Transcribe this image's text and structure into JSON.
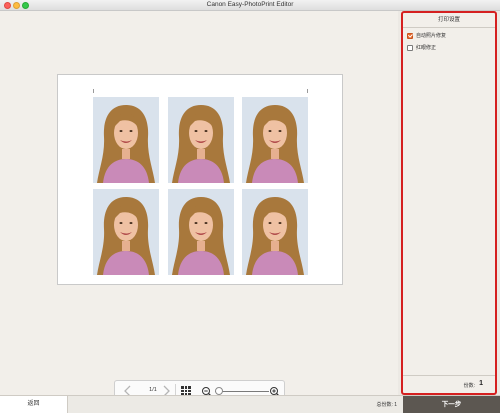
{
  "window": {
    "title": "Canon Easy-PhotoPrint Editor"
  },
  "preview": {
    "photo_count": 6,
    "page_indicator": "1/1"
  },
  "toolbar": {
    "prev_icon": "chevron-left-icon",
    "next_icon": "chevron-right-icon",
    "grid_icon": "grid-icon",
    "zoom_out_icon": "zoom-out-icon",
    "zoom_in_icon": "zoom-in-icon",
    "zoom_level": 0
  },
  "panel": {
    "header": "打印设置",
    "options": [
      {
        "label": "自动照片修复",
        "checked": true
      },
      {
        "label": "红眼修正",
        "checked": false
      }
    ],
    "copies_label": "份数:",
    "copies_value": "1"
  },
  "statusbar": {
    "back_label": "返回",
    "total_copies": "总份数: 1",
    "next_label": "下一步"
  },
  "colors": {
    "highlight_border": "#d52020",
    "checkbox_checked": "#e8692b",
    "next_button": "#5c5751"
  }
}
